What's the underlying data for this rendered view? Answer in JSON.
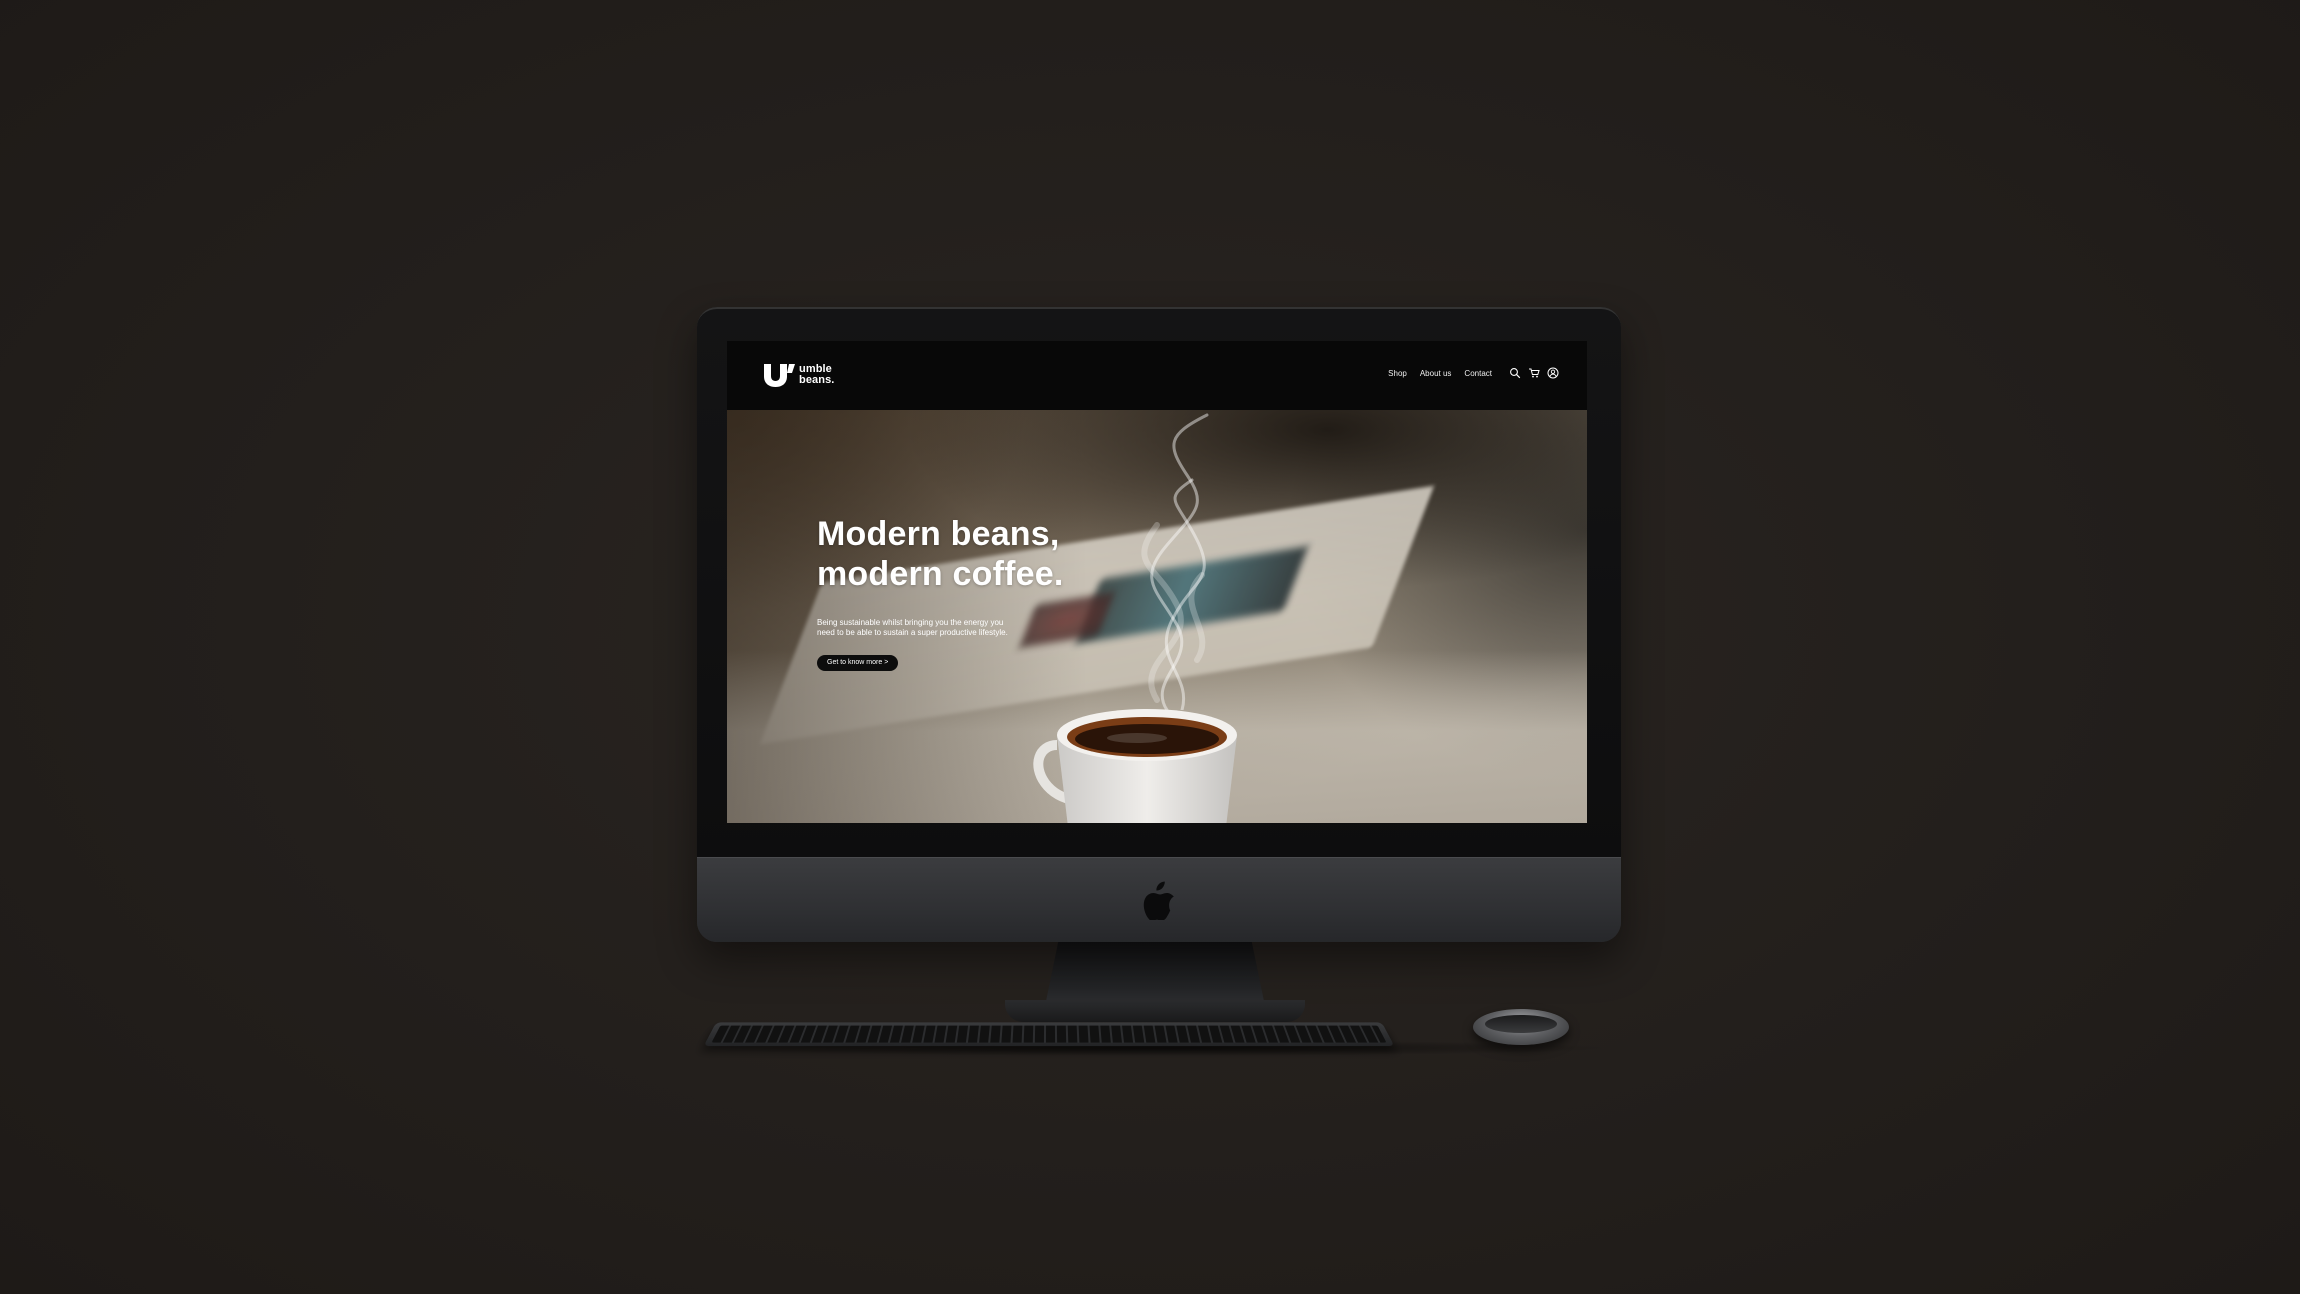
{
  "site": {
    "brand": {
      "line1": "umble",
      "line2": "beans."
    },
    "nav": {
      "shop": "Shop",
      "about": "About us",
      "contact": "Contact"
    },
    "icons": [
      "search-icon",
      "cart-icon",
      "account-icon"
    ],
    "hero": {
      "title_line1": "Modern beans,",
      "title_line2": "modern coffee.",
      "subtitle_line1": "Being sustainable whilst bringing you the energy you",
      "subtitle_line2": "need to be able to sustain a super productive lifestyle.",
      "cta": "Get to know more >"
    }
  },
  "colors": {
    "background": "#221e1b",
    "header": "#080808",
    "cta_bg": "#0d0d0d",
    "text": "#ffffff"
  }
}
